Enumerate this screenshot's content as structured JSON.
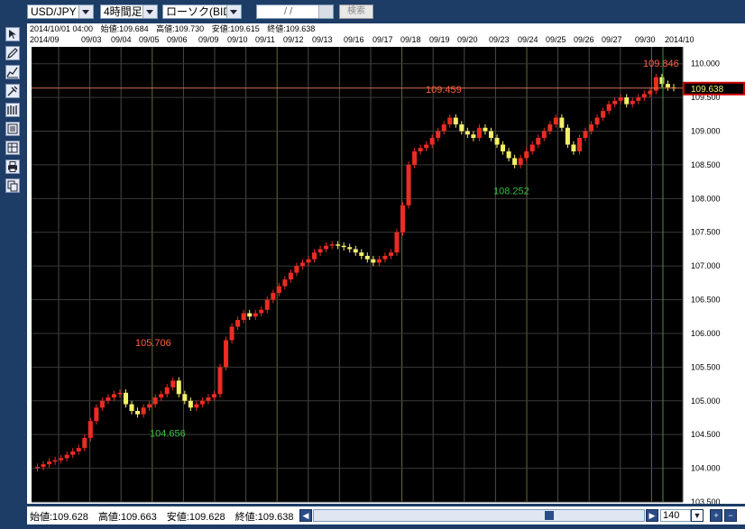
{
  "toolbar": {
    "symbol": "USD/JPY",
    "timeframe": "4時間足",
    "chart_type": "ローソク(BID)",
    "date_field": "/ /",
    "search_label": "検索"
  },
  "sidebar_icons": [
    "cursor-icon",
    "pencil-icon",
    "line-chart-icon",
    "tool-icon",
    "bars-icon",
    "sheet-icon",
    "table-icon",
    "print-icon",
    "copy-icon"
  ],
  "info": {
    "datetime": "2014/10/01 04:00",
    "open": "始値:109.684",
    "high": "高値:109.730",
    "low": "安値:109.615",
    "close": "終値:109.638"
  },
  "bottom": {
    "open": "始値:109.628",
    "high": "高値:109.663",
    "low": "安値:109.628",
    "close": "終値:109.638",
    "zoom": "140"
  },
  "colors": {
    "bull": "#ea2c23",
    "bear": "#f3f06a",
    "annotation_high": "#ff6040",
    "annotation_low": "#35c040",
    "price_line": "#d07050"
  },
  "chart_data": {
    "type": "candlestick",
    "month_start_label": "2014/09",
    "month_end_label": "2014/10",
    "date_labels": [
      "09/03",
      "09/04",
      "09/05",
      "09/06",
      "09/09",
      "09/10",
      "09/11",
      "09/12",
      "09/13",
      "09/16",
      "09/17",
      "09/18",
      "09/19",
      "09/20",
      "09/23",
      "09/24",
      "09/25",
      "09/26",
      "09/27",
      "09/30"
    ],
    "y_ticks": [
      "110.000",
      "109.500",
      "109.000",
      "108.500",
      "108.000",
      "107.500",
      "107.000",
      "106.500",
      "106.000",
      "105.500",
      "105.000",
      "104.500",
      "104.000",
      "103.500"
    ],
    "ylim": [
      103.5,
      110.25
    ],
    "current_price": "109.638",
    "annotations": [
      {
        "text": "109.846",
        "value": 109.846,
        "kind": "high"
      },
      {
        "text": "109.459",
        "value": 109.459,
        "kind": "high"
      },
      {
        "text": "108.252",
        "value": 108.252,
        "kind": "low"
      },
      {
        "text": "105.706",
        "value": 105.706,
        "kind": "high"
      },
      {
        "text": "104.656",
        "value": 104.656,
        "kind": "low"
      }
    ],
    "closes": [
      104.02,
      104.06,
      104.1,
      104.12,
      104.15,
      104.2,
      104.25,
      104.3,
      104.45,
      104.7,
      104.9,
      105.0,
      105.05,
      105.1,
      105.12,
      104.95,
      104.85,
      104.8,
      104.9,
      104.95,
      105.05,
      105.1,
      105.2,
      105.3,
      105.1,
      105.0,
      104.9,
      104.95,
      105.0,
      105.05,
      105.1,
      105.5,
      105.9,
      106.1,
      106.2,
      106.3,
      106.25,
      106.3,
      106.35,
      106.5,
      106.6,
      106.7,
      106.8,
      106.9,
      107.0,
      107.05,
      107.1,
      107.2,
      107.25,
      107.3,
      107.32,
      107.3,
      107.28,
      107.25,
      107.2,
      107.15,
      107.1,
      107.05,
      107.1,
      107.15,
      107.2,
      107.5,
      107.9,
      108.5,
      108.7,
      108.75,
      108.8,
      108.9,
      109.0,
      109.1,
      109.2,
      109.1,
      109.0,
      108.95,
      108.9,
      109.05,
      109.0,
      108.9,
      108.8,
      108.7,
      108.6,
      108.5,
      108.6,
      108.7,
      108.8,
      108.9,
      109.0,
      109.1,
      109.2,
      109.05,
      108.8,
      108.7,
      108.9,
      109.0,
      109.1,
      109.2,
      109.3,
      109.4,
      109.45,
      109.5,
      109.4,
      109.45,
      109.5,
      109.55,
      109.6,
      109.8,
      109.7,
      109.65,
      109.64
    ]
  }
}
